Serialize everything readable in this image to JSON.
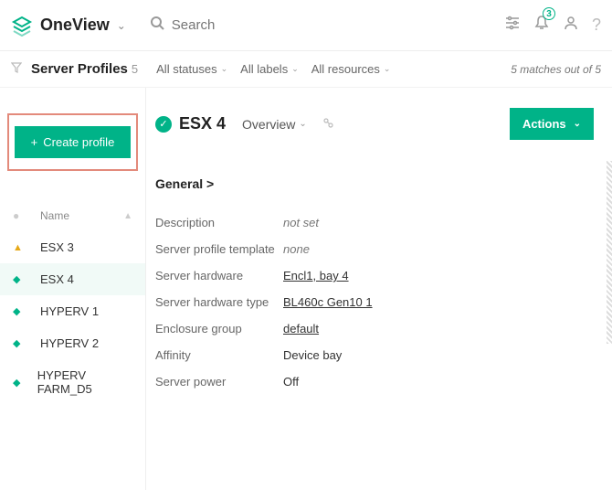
{
  "header": {
    "app_title": "OneView",
    "search_placeholder": "Search",
    "notification_count": "3"
  },
  "filters": {
    "section_title": "Server Profiles",
    "section_count": "5",
    "all_statuses": "All statuses",
    "all_labels": "All labels",
    "all_resources": "All resources",
    "matches_text": "5 matches out of 5"
  },
  "sidebar": {
    "create_label": "Create profile",
    "name_header": "Name",
    "profiles": [
      {
        "name": "ESX 3",
        "status": "amber"
      },
      {
        "name": "ESX 4",
        "status": "green",
        "selected": true
      },
      {
        "name": "HYPERV 1",
        "status": "green"
      },
      {
        "name": "HYPERV 2",
        "status": "green"
      },
      {
        "name": "HYPERV FARM_D5",
        "status": "green"
      }
    ]
  },
  "detail": {
    "title": "ESX 4",
    "view_label": "Overview",
    "actions_label": "Actions",
    "general_label": "General >",
    "properties": [
      {
        "label": "Description",
        "value": "not set",
        "style": "italic"
      },
      {
        "label": "Server profile template",
        "value": "none",
        "style": "italic"
      },
      {
        "label": "Server hardware",
        "value": "Encl1, bay 4",
        "style": "link"
      },
      {
        "label": "Server hardware type",
        "value": "BL460c Gen10 1",
        "style": "link"
      },
      {
        "label": "Enclosure group",
        "value": "default",
        "style": "link"
      },
      {
        "label": "Affinity",
        "value": "Device bay",
        "style": ""
      },
      {
        "label": "Server power",
        "value": "Off",
        "style": ""
      }
    ]
  }
}
